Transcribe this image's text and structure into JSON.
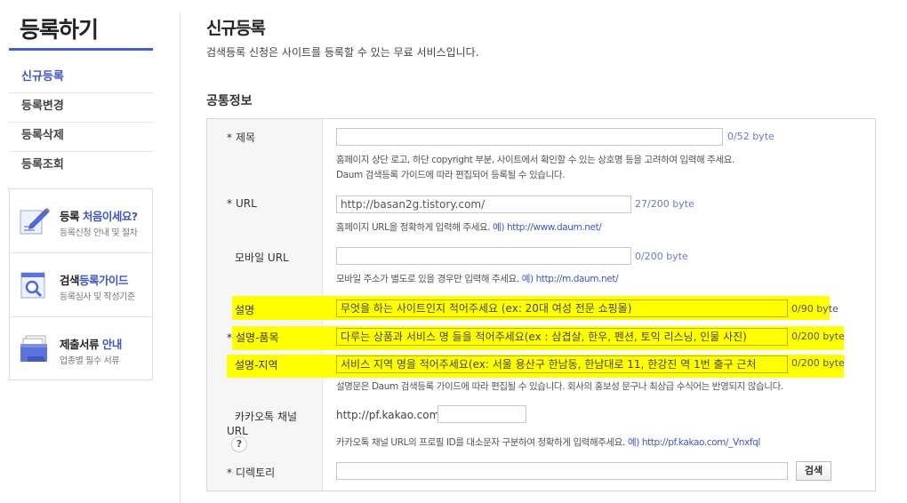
{
  "sidebar": {
    "title": "등록하기",
    "menu": [
      "신규등록",
      "등록변경",
      "등록삭제",
      "등록조회"
    ],
    "promos": [
      {
        "title_pre": "등록 ",
        "title_hl": "처음이세요?",
        "sub": "등록신청 안내 및 절차",
        "icon": "pencil-document-icon"
      },
      {
        "title_pre": "검색",
        "title_hl": "등록가이드",
        "sub": "등록심사 및 작성기준",
        "icon": "magnifier-document-icon"
      },
      {
        "title_pre": "제출서류 ",
        "title_hl": "안내",
        "sub": "업종별 필수 서류",
        "icon": "folder-documents-icon"
      }
    ]
  },
  "main": {
    "title": "신규등록",
    "description": "검색등록 신청은 사이트를 등록할 수 있는 무료 서비스입니다.",
    "section_title": "공통정보"
  },
  "form": {
    "required_mark": "*",
    "title": {
      "label": "제목",
      "value": "",
      "counter_num": "0",
      "counter_rest": "/52 byte",
      "help1": "홈페이지 상단 로고, 하단 copyright 부분, 사이트에서 확인할 수 있는 상호명 등을 고려하여 입력해 주세요.",
      "help2": "Daum 검색등록 가이드에 따라 편집되어 등록될 수 있습니다."
    },
    "url": {
      "label": "URL",
      "value": "http://basan2g.tistory.com/",
      "counter_num": "27",
      "counter_rest": "/200 byte",
      "help_text": "홈페이지 URL을 정확하게 입력해 주세요. ",
      "help_example": "예) http://www.daum.net/"
    },
    "mobile_url": {
      "label": "모바일 URL",
      "value": "",
      "counter_num": "0",
      "counter_rest": "/200 byte",
      "help_text": "모바일 주소가 별도로 있을 경우만 입력해 주세요. ",
      "help_example": "예) http://m.daum.net/"
    },
    "description": {
      "label": "설명",
      "value": "무엇을 하는 사이트인지 적어주세요 (ex: 20대 여성 전문 쇼핑몰)",
      "counter_num": "0",
      "counter_rest": "/90 byte"
    },
    "products": {
      "label": "설명-품목",
      "value": "다루는 상품과 서비스 명 들을 적어주세요(ex : 삼겹살, 한우, 펜션, 토익 리스닝, 인물 사진)",
      "counter_num": "0",
      "counter_rest": "/200 byte"
    },
    "region": {
      "label": "설명-지역",
      "value": "서비스 지역 명을 적어주세요(ex: 서울  용산구 한남동, 한남대로 11, 한강진 역 1번 출구 근처",
      "counter_num": "0",
      "counter_rest": "/200 byte",
      "help": "설명문은 Daum 검색등록 가이드에 따라 편집될 수 있습니다. 회사의 홍보성 문구나 최상급 수식어는 반영되지 않습니다."
    },
    "kakao": {
      "label_line1": "카카오톡 채널",
      "label_line2": "URL",
      "qmark": "?",
      "prefix": "http://pf.kakao.com/",
      "value": "",
      "help_text": "카카오톡 채널 URL의 프로필 ID를 대소문자 구분하여 정확하게 입력해주세요. ",
      "help_example": "예) http://pf.kakao.com/_Vnxfql"
    },
    "directory": {
      "label": "디렉토리",
      "value": "",
      "button": "검색"
    }
  },
  "colors": {
    "accent": "#3f56c6",
    "highlight": "#ffff00"
  }
}
